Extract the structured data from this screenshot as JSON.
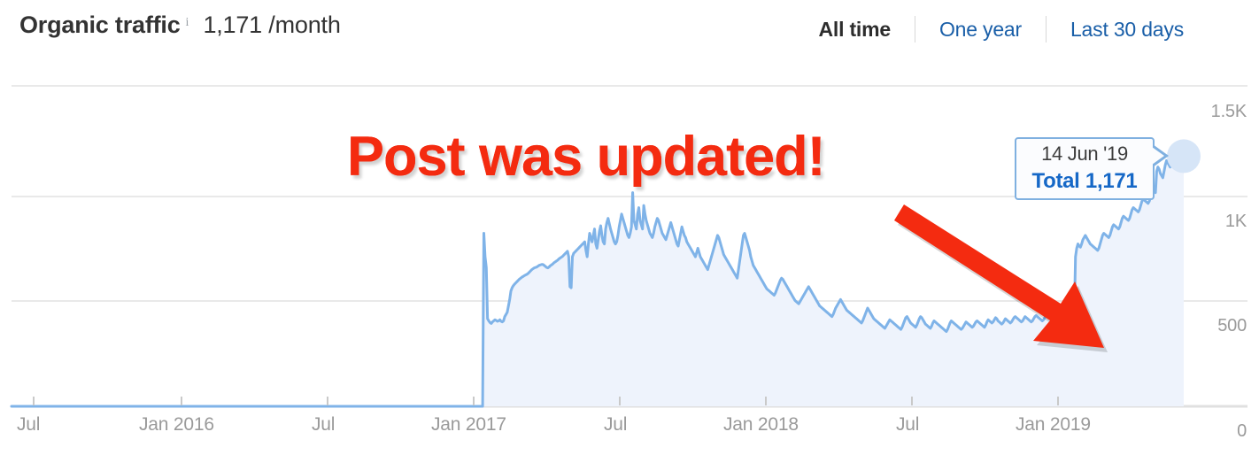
{
  "header": {
    "title": "Organic traffic",
    "info_icon": "info-icon",
    "value": "1,171 /month",
    "ranges": [
      {
        "label": "All time",
        "active": true
      },
      {
        "label": "One year",
        "active": false
      },
      {
        "label": "Last 30 days",
        "active": false
      }
    ]
  },
  "tooltip": {
    "date": "14 Jun '19",
    "total": "Total 1,171"
  },
  "annotation": {
    "text": "Post was updated!",
    "color": "#f42b10",
    "arrow": "arrow-pointing-down-right"
  },
  "colors": {
    "line": "#7fb3e8",
    "area": "#eef3fc",
    "grid": "#e9e9e9",
    "link": "#1a5fa8",
    "annotation_red": "#f42b10",
    "tooltip_border": "#7fb0e0",
    "point_halo": "#d6e5f7"
  },
  "chart_data": {
    "type": "area",
    "title": "Organic traffic",
    "xlabel": "",
    "ylabel": "",
    "ylim": [
      0,
      1500
    ],
    "yticks": [
      1500,
      1000,
      500,
      0
    ],
    "ytick_labels": [
      "1.5K",
      "1K",
      "500",
      "0"
    ],
    "xtick_labels": [
      "Jul",
      "Jan 2016",
      "Jul",
      "Jan 2017",
      "Jul",
      "Jan 2018",
      "Jul",
      "Jan 2019"
    ],
    "grid": true,
    "legend": null,
    "highlight_point": {
      "label": "14 Jun '19",
      "value": 1171
    },
    "series": [
      {
        "name": "Organic traffic",
        "values": [
          0,
          0,
          0,
          0,
          0,
          0,
          0,
          0,
          0,
          0,
          0,
          0,
          0,
          0,
          0,
          0,
          0,
          0,
          0,
          0,
          0,
          0,
          0,
          0,
          0,
          0,
          0,
          0,
          0,
          0,
          0,
          0,
          0,
          0,
          0,
          0,
          0,
          0,
          0,
          0,
          0,
          0,
          0,
          0,
          0,
          0,
          0,
          0,
          0,
          0,
          0,
          0,
          0,
          0,
          0,
          0,
          0,
          0,
          0,
          0,
          0,
          0,
          0,
          0,
          0,
          0,
          0,
          0,
          0,
          0,
          0,
          0,
          0,
          0,
          0,
          0,
          0,
          0,
          0,
          0,
          0,
          0,
          0,
          0,
          0,
          0,
          0,
          0,
          0,
          0,
          0,
          0,
          0,
          0,
          0,
          0,
          0,
          0,
          0,
          0,
          0,
          0,
          0,
          0,
          0,
          0,
          0,
          0,
          0,
          0,
          0,
          0,
          0,
          0,
          0,
          0,
          0,
          0,
          0,
          0,
          0,
          0,
          0,
          0,
          0,
          0,
          0,
          0,
          0,
          0,
          0,
          0,
          0,
          0,
          0,
          0,
          0,
          0,
          0,
          0,
          0,
          0,
          0,
          0,
          0,
          0,
          0,
          0,
          0,
          0,
          0,
          0,
          0,
          0,
          0,
          0,
          0,
          0,
          0,
          0,
          0,
          0,
          0,
          0,
          0,
          0,
          0,
          0,
          0,
          0,
          0,
          0,
          0,
          0,
          0,
          0,
          0,
          0,
          0,
          0,
          0,
          0,
          0,
          0,
          0,
          0,
          0,
          0,
          0,
          0,
          0,
          0,
          0,
          0,
          0,
          0,
          0,
          0,
          0,
          0,
          0,
          0,
          0,
          0,
          0,
          0,
          0,
          0,
          0,
          0,
          0,
          0,
          0,
          0,
          0,
          0,
          0,
          0,
          0,
          0,
          0,
          0,
          0,
          0,
          0,
          0,
          0,
          0,
          0,
          0,
          0,
          0,
          0,
          0,
          0,
          0,
          0,
          0,
          0,
          0,
          0,
          0,
          0,
          0,
          0,
          0,
          0,
          0,
          0,
          0,
          0,
          0,
          0,
          0,
          0,
          0,
          0,
          0,
          0,
          0,
          0,
          0,
          0,
          0,
          0,
          0,
          0,
          0,
          0,
          0,
          0,
          0,
          0,
          0,
          0,
          0,
          0,
          0,
          0,
          0,
          0,
          0,
          0,
          0,
          0,
          0,
          0,
          0,
          0,
          0,
          0,
          0,
          0,
          0,
          0,
          0,
          0,
          0,
          0,
          0,
          0,
          0,
          0,
          0,
          0,
          0,
          0,
          0,
          0,
          0,
          0,
          0,
          0,
          0,
          0,
          0,
          0,
          0,
          0,
          0,
          0,
          0,
          0,
          0,
          0,
          0,
          0,
          0,
          0,
          0,
          0,
          0,
          0,
          0,
          0,
          0,
          0,
          0,
          0,
          0,
          0,
          0,
          0,
          0,
          0,
          0,
          0,
          0,
          0,
          0,
          0,
          0,
          0,
          0,
          0,
          0,
          0,
          0,
          0,
          0,
          0,
          0,
          0,
          0,
          0,
          0,
          0,
          0,
          0,
          0,
          0,
          0,
          0,
          0,
          0,
          0,
          0,
          0,
          0,
          0,
          0,
          0,
          0,
          0,
          810,
          700,
          650,
          410,
          400,
          392,
          388,
          395,
          400,
          405,
          402,
          398,
          400,
          405,
          398,
          395,
          400,
          420,
          430,
          440,
          470,
          500,
          540,
          555,
          565,
          572,
          578,
          584,
          590,
          596,
          600,
          605,
          608,
          612,
          615,
          618,
          622,
          628,
          634,
          640,
          644,
          648,
          650,
          652,
          656,
          660,
          662,
          664,
          664,
          660,
          655,
          650,
          648,
          652,
          658,
          662,
          666,
          672,
          676,
          680,
          684,
          690,
          694,
          698,
          702,
          708,
          714,
          720,
          726,
          700,
          560,
          555,
          700,
          716,
          722,
          728,
          734,
          740,
          746,
          752,
          758,
          764,
          770,
          730,
          700,
          760,
          810,
          790,
          770,
          800,
          830,
          760,
          740,
          780,
          820,
          845,
          800,
          770,
          760,
          830,
          860,
          880,
          855,
          830,
          810,
          790,
          770,
          760,
          770,
          800,
          840,
          870,
          900,
          880,
          860,
          840,
          820,
          800,
          790,
          810,
          840,
          1000,
          870,
          850,
          830,
          900,
          930,
          870,
          850,
          830,
          940,
          900,
          870,
          850,
          830,
          810,
          800,
          790,
          810,
          840,
          860,
          880,
          870,
          850,
          830,
          810,
          800,
          790,
          780,
          800,
          820,
          840,
          860,
          840,
          820,
          800,
          780,
          760,
          750,
          780,
          810,
          840,
          820,
          800,
          790,
          770,
          760,
          750,
          740,
          730,
          720,
          710,
          700,
          720,
          740,
          720,
          700,
          690,
          680,
          670,
          660,
          650,
          640,
          660,
          680,
          700,
          720,
          740,
          760,
          780,
          800,
          790,
          770,
          750,
          730,
          710,
          700,
          690,
          680,
          670,
          660,
          650,
          640,
          630,
          620,
          610,
          600,
          640,
          680,
          720,
          760,
          800,
          810,
          790,
          770,
          750,
          730,
          700,
          680,
          660,
          650,
          640,
          630,
          620,
          610,
          600,
          590,
          580,
          570,
          560,
          550,
          545,
          540,
          535,
          530,
          525,
          520,
          530,
          545,
          560,
          575,
          590,
          600,
          595,
          585,
          575,
          565,
          555,
          545,
          535,
          525,
          515,
          505,
          495,
          490,
          485,
          480,
          490,
          500,
          510,
          520,
          530,
          540,
          550,
          560,
          550,
          540,
          530,
          520,
          510,
          500,
          490,
          480,
          470,
          465,
          460,
          455,
          450,
          445,
          440,
          435,
          430,
          425,
          420,
          430,
          445,
          460,
          470,
          480,
          490,
          500,
          490,
          480,
          470,
          460,
          450,
          445,
          440,
          435,
          430,
          425,
          420,
          415,
          410,
          405,
          400,
          395,
          390,
          400,
          415,
          430,
          445,
          460,
          450,
          440,
          430,
          420,
          410,
          405,
          400,
          395,
          390,
          385,
          380,
          375,
          370,
          365,
          375,
          385,
          395,
          405,
          400,
          395,
          390,
          385,
          380,
          375,
          370,
          365,
          360,
          370,
          385,
          400,
          415,
          420,
          410,
          400,
          390,
          385,
          380,
          375,
          370,
          380,
          395,
          410,
          420,
          415,
          405,
          395,
          385,
          380,
          375,
          370,
          365,
          375,
          390,
          400,
          395,
          390,
          385,
          380,
          375,
          370,
          365,
          360,
          355,
          350,
          360,
          375,
          390,
          400,
          395,
          390,
          385,
          380,
          375,
          370,
          365,
          360,
          365,
          375,
          385,
          395,
          390,
          385,
          380,
          375,
          370,
          375,
          385,
          395,
          400,
          395,
          390,
          385,
          380,
          375,
          370,
          380,
          395,
          405,
          400,
          395,
          390,
          395,
          405,
          415,
          410,
          400,
          395,
          390,
          385,
          390,
          400,
          410,
          405,
          400,
          395,
          390,
          395,
          405,
          415,
          420,
          415,
          410,
          405,
          400,
          395,
          400,
          410,
          420,
          415,
          410,
          405,
          400,
          395,
          400,
          410,
          420,
          425,
          420,
          415,
          410,
          405,
          400,
          405,
          415,
          425,
          430,
          425,
          420,
          415,
          410,
          405,
          410,
          420,
          430,
          435,
          430,
          425,
          420,
          415,
          410,
          405,
          400,
          405,
          415,
          425,
          430,
          425,
          420,
          700,
          740,
          760,
          750,
          745,
          760,
          780,
          790,
          800,
          790,
          780,
          770,
          760,
          755,
          750,
          745,
          740,
          735,
          730,
          740,
          760,
          780,
          800,
          810,
          805,
          800,
          795,
          790,
          800,
          820,
          840,
          850,
          845,
          840,
          835,
          830,
          840,
          860,
          880,
          890,
          885,
          880,
          875,
          870,
          880,
          900,
          920,
          930,
          925,
          920,
          915,
          910,
          920,
          940,
          960,
          970,
          965,
          960,
          955,
          950,
          960,
          980,
          1000,
          1010,
          1005,
          1000,
          1100,
          1120,
          1110,
          1090,
          1080,
          1070,
          1100,
          1130,
          1150,
          1140,
          1130,
          1120,
          1140,
          1160,
          1150,
          1140,
          1130,
          1150,
          1170,
          1160,
          1150,
          1160,
          1171
        ]
      }
    ]
  }
}
